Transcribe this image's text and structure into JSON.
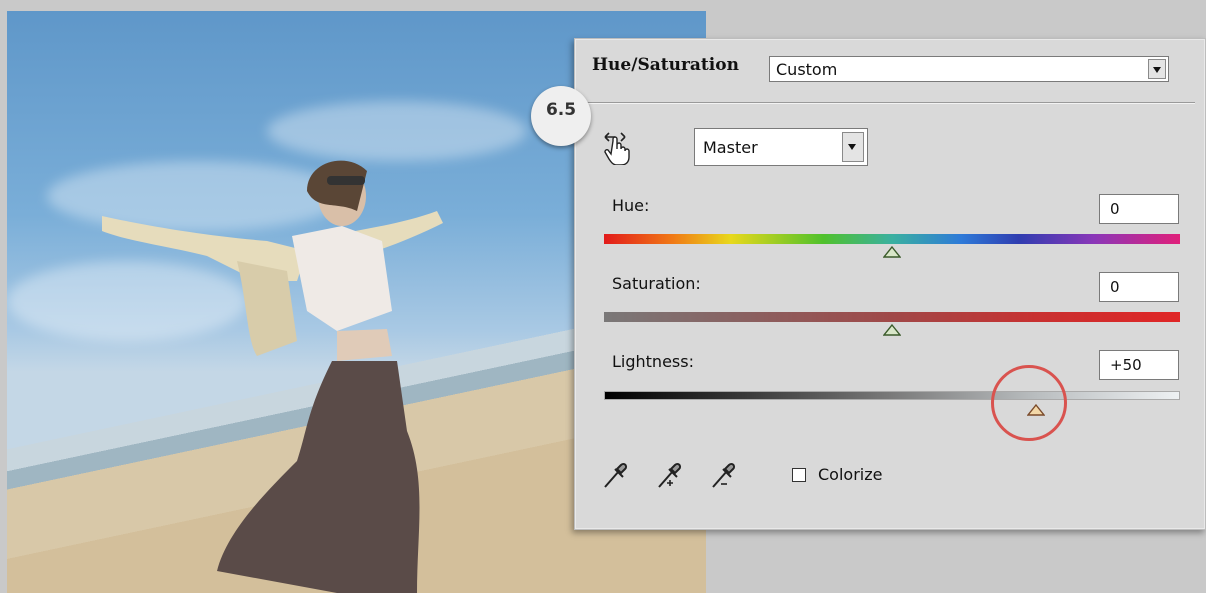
{
  "dialog": {
    "title": "Hue/Saturation",
    "preset": "Custom",
    "step_badge": "6.5",
    "edit_channel": "Master",
    "hue": {
      "label": "Hue:",
      "value": "0",
      "slider_fraction": 0.5
    },
    "saturation": {
      "label": "Saturation:",
      "value": "0",
      "slider_fraction": 0.5
    },
    "lightness": {
      "label": "Lightness:",
      "value": "+50",
      "slider_fraction": 0.75
    },
    "colorize": {
      "label": "Colorize",
      "checked": false
    }
  },
  "colors": {
    "highlight_ring": "#d9534f",
    "panel_bg": "#d9d9d9"
  },
  "icons": [
    "targeted-adjustment-hand-icon",
    "eyedropper-icon",
    "eyedropper-plus-icon",
    "eyedropper-minus-icon"
  ]
}
